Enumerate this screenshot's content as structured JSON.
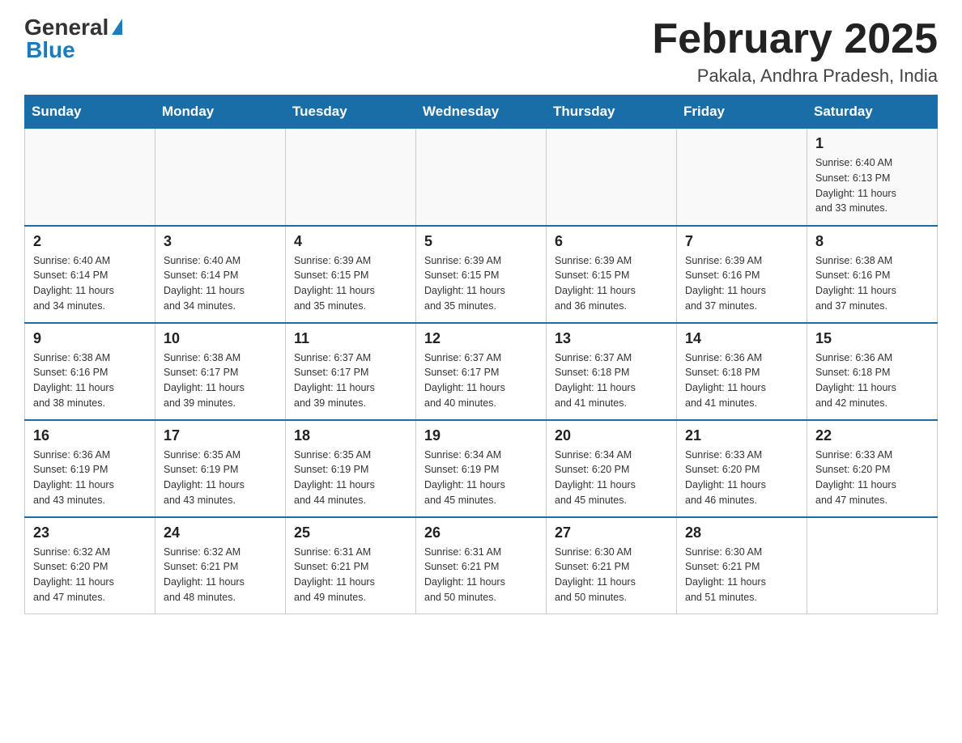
{
  "header": {
    "logo_general": "General",
    "logo_blue": "Blue",
    "month_title": "February 2025",
    "location": "Pakala, Andhra Pradesh, India"
  },
  "days_of_week": [
    "Sunday",
    "Monday",
    "Tuesday",
    "Wednesday",
    "Thursday",
    "Friday",
    "Saturday"
  ],
  "weeks": [
    [
      {
        "day": "",
        "info": ""
      },
      {
        "day": "",
        "info": ""
      },
      {
        "day": "",
        "info": ""
      },
      {
        "day": "",
        "info": ""
      },
      {
        "day": "",
        "info": ""
      },
      {
        "day": "",
        "info": ""
      },
      {
        "day": "1",
        "info": "Sunrise: 6:40 AM\nSunset: 6:13 PM\nDaylight: 11 hours\nand 33 minutes."
      }
    ],
    [
      {
        "day": "2",
        "info": "Sunrise: 6:40 AM\nSunset: 6:14 PM\nDaylight: 11 hours\nand 34 minutes."
      },
      {
        "day": "3",
        "info": "Sunrise: 6:40 AM\nSunset: 6:14 PM\nDaylight: 11 hours\nand 34 minutes."
      },
      {
        "day": "4",
        "info": "Sunrise: 6:39 AM\nSunset: 6:15 PM\nDaylight: 11 hours\nand 35 minutes."
      },
      {
        "day": "5",
        "info": "Sunrise: 6:39 AM\nSunset: 6:15 PM\nDaylight: 11 hours\nand 35 minutes."
      },
      {
        "day": "6",
        "info": "Sunrise: 6:39 AM\nSunset: 6:15 PM\nDaylight: 11 hours\nand 36 minutes."
      },
      {
        "day": "7",
        "info": "Sunrise: 6:39 AM\nSunset: 6:16 PM\nDaylight: 11 hours\nand 37 minutes."
      },
      {
        "day": "8",
        "info": "Sunrise: 6:38 AM\nSunset: 6:16 PM\nDaylight: 11 hours\nand 37 minutes."
      }
    ],
    [
      {
        "day": "9",
        "info": "Sunrise: 6:38 AM\nSunset: 6:16 PM\nDaylight: 11 hours\nand 38 minutes."
      },
      {
        "day": "10",
        "info": "Sunrise: 6:38 AM\nSunset: 6:17 PM\nDaylight: 11 hours\nand 39 minutes."
      },
      {
        "day": "11",
        "info": "Sunrise: 6:37 AM\nSunset: 6:17 PM\nDaylight: 11 hours\nand 39 minutes."
      },
      {
        "day": "12",
        "info": "Sunrise: 6:37 AM\nSunset: 6:17 PM\nDaylight: 11 hours\nand 40 minutes."
      },
      {
        "day": "13",
        "info": "Sunrise: 6:37 AM\nSunset: 6:18 PM\nDaylight: 11 hours\nand 41 minutes."
      },
      {
        "day": "14",
        "info": "Sunrise: 6:36 AM\nSunset: 6:18 PM\nDaylight: 11 hours\nand 41 minutes."
      },
      {
        "day": "15",
        "info": "Sunrise: 6:36 AM\nSunset: 6:18 PM\nDaylight: 11 hours\nand 42 minutes."
      }
    ],
    [
      {
        "day": "16",
        "info": "Sunrise: 6:36 AM\nSunset: 6:19 PM\nDaylight: 11 hours\nand 43 minutes."
      },
      {
        "day": "17",
        "info": "Sunrise: 6:35 AM\nSunset: 6:19 PM\nDaylight: 11 hours\nand 43 minutes."
      },
      {
        "day": "18",
        "info": "Sunrise: 6:35 AM\nSunset: 6:19 PM\nDaylight: 11 hours\nand 44 minutes."
      },
      {
        "day": "19",
        "info": "Sunrise: 6:34 AM\nSunset: 6:19 PM\nDaylight: 11 hours\nand 45 minutes."
      },
      {
        "day": "20",
        "info": "Sunrise: 6:34 AM\nSunset: 6:20 PM\nDaylight: 11 hours\nand 45 minutes."
      },
      {
        "day": "21",
        "info": "Sunrise: 6:33 AM\nSunset: 6:20 PM\nDaylight: 11 hours\nand 46 minutes."
      },
      {
        "day": "22",
        "info": "Sunrise: 6:33 AM\nSunset: 6:20 PM\nDaylight: 11 hours\nand 47 minutes."
      }
    ],
    [
      {
        "day": "23",
        "info": "Sunrise: 6:32 AM\nSunset: 6:20 PM\nDaylight: 11 hours\nand 47 minutes."
      },
      {
        "day": "24",
        "info": "Sunrise: 6:32 AM\nSunset: 6:21 PM\nDaylight: 11 hours\nand 48 minutes."
      },
      {
        "day": "25",
        "info": "Sunrise: 6:31 AM\nSunset: 6:21 PM\nDaylight: 11 hours\nand 49 minutes."
      },
      {
        "day": "26",
        "info": "Sunrise: 6:31 AM\nSunset: 6:21 PM\nDaylight: 11 hours\nand 50 minutes."
      },
      {
        "day": "27",
        "info": "Sunrise: 6:30 AM\nSunset: 6:21 PM\nDaylight: 11 hours\nand 50 minutes."
      },
      {
        "day": "28",
        "info": "Sunrise: 6:30 AM\nSunset: 6:21 PM\nDaylight: 11 hours\nand 51 minutes."
      },
      {
        "day": "",
        "info": ""
      }
    ]
  ]
}
